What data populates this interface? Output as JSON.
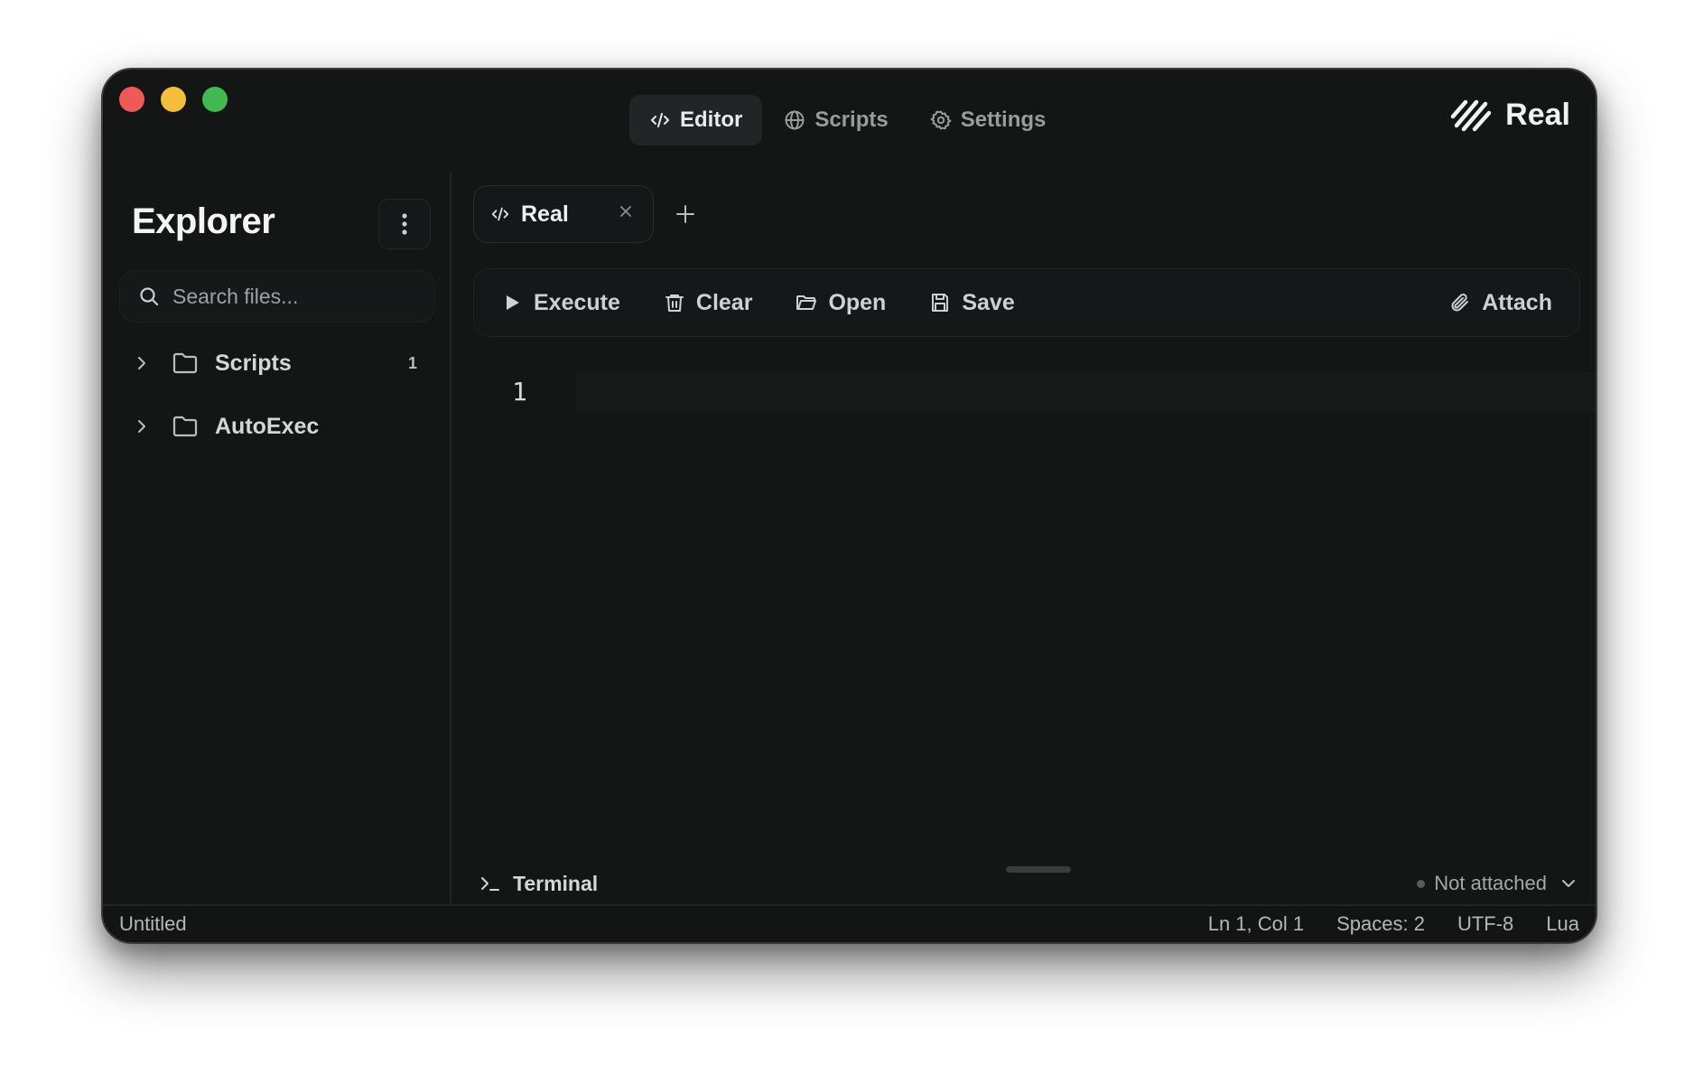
{
  "app": {
    "brand": "Real"
  },
  "nav": {
    "tabs": [
      {
        "label": "Editor",
        "icon": "code-icon",
        "active": true
      },
      {
        "label": "Scripts",
        "icon": "globe-icon",
        "active": false
      },
      {
        "label": "Settings",
        "icon": "gear-icon",
        "active": false
      }
    ]
  },
  "sidebar": {
    "title": "Explorer",
    "search_placeholder": "Search files...",
    "items": [
      {
        "label": "Scripts",
        "count": "1"
      },
      {
        "label": "AutoExec",
        "count": ""
      }
    ]
  },
  "editor": {
    "tabs": [
      {
        "label": "Real"
      }
    ],
    "line_numbers": [
      "1"
    ]
  },
  "toolbar": {
    "execute": "Execute",
    "clear": "Clear",
    "open": "Open",
    "save": "Save",
    "attach": "Attach"
  },
  "terminal": {
    "label": "Terminal",
    "status": "Not attached"
  },
  "statusbar": {
    "file": "Untitled",
    "position": "Ln 1, Col 1",
    "spaces": "Spaces: 2",
    "encoding": "UTF-8",
    "language": "Lua"
  },
  "colors": {
    "window_bg": "#141515",
    "traffic_red": "#ee5b57",
    "traffic_yellow": "#f4be3a",
    "traffic_green": "#3fb950"
  }
}
